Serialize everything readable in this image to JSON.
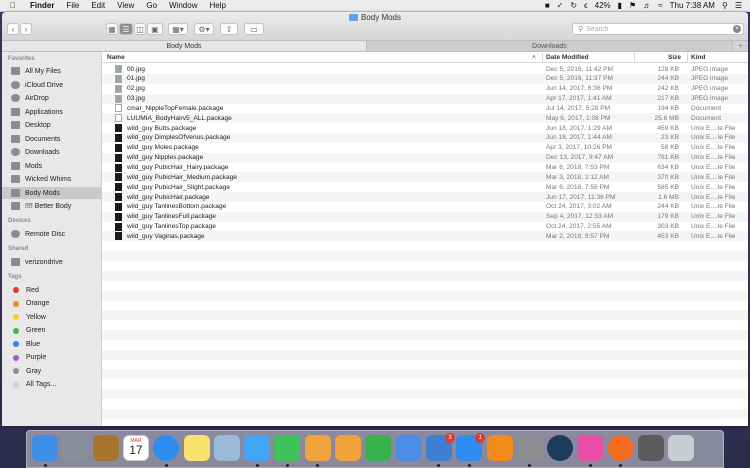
{
  "menubar": {
    "app_name": "Finder",
    "menus": [
      "File",
      "Edit",
      "View",
      "Go",
      "Window",
      "Help"
    ],
    "battery": "42%",
    "clock": "Thu 7:38 AM"
  },
  "window": {
    "title": "Body Mods",
    "search_placeholder": "Search",
    "tabs": [
      "Body Mods",
      "Downloads"
    ],
    "plus": "+"
  },
  "sidebar": {
    "favorites_label": "Favorites",
    "favorites": [
      "All My Files",
      "iCloud Drive",
      "AirDrop",
      "Applications",
      "Desktop",
      "Documents",
      "Downloads",
      "Mods",
      "Wicked Whims",
      "Body Mods",
      "!!!! Better Body"
    ],
    "selected": "Body Mods",
    "devices_label": "Devices",
    "devices": [
      "Remote Disc"
    ],
    "shared_label": "Shared",
    "shared": [
      "verizondrive"
    ],
    "tags_label": "Tags",
    "tags": [
      {
        "label": "Red",
        "color": "#e0372e"
      },
      {
        "label": "Orange",
        "color": "#f28a1c"
      },
      {
        "label": "Yellow",
        "color": "#f4cc2a"
      },
      {
        "label": "Green",
        "color": "#3bb94a"
      },
      {
        "label": "Blue",
        "color": "#2f7ff0"
      },
      {
        "label": "Purple",
        "color": "#a65bd0"
      },
      {
        "label": "Gray",
        "color": "#8e8e93"
      },
      {
        "label": "All Tags...",
        "color": "#d0d0d0"
      }
    ]
  },
  "list": {
    "columns": {
      "name": "Name",
      "date": "Date Modified",
      "size": "Size",
      "kind": "Kind"
    },
    "rows": [
      {
        "name": "00.jpg",
        "date": "Dec 5, 2016, 11:42 PM",
        "size": "128 KB",
        "kind": "JPEG image",
        "icon": "jpg"
      },
      {
        "name": "01.jpg",
        "date": "Dec 5, 2016, 11:37 PM",
        "size": "244 KB",
        "kind": "JPEG image",
        "icon": "jpg"
      },
      {
        "name": "02.jpg",
        "date": "Jun 14, 2017, 6:36 PM",
        "size": "242 KB",
        "kind": "JPEG image",
        "icon": "jpg"
      },
      {
        "name": "03.jpg",
        "date": "Apr 17, 2017, 1:41 AM",
        "size": "217 KB",
        "kind": "JPEG image",
        "icon": "jpg"
      },
      {
        "name": "cmar_NippleTopFemale.package",
        "date": "Jul 14, 2017, 5:28 PM",
        "size": "194 KB",
        "kind": "Document",
        "icon": "doc"
      },
      {
        "name": "LUUMIA_BodyHairv5_ALL.package",
        "date": "May 6, 2017, 1:08 PM",
        "size": "25.6 MB",
        "kind": "Document",
        "icon": "doc"
      },
      {
        "name": "wild_guy Butts.package",
        "date": "Jun 18, 2017, 1:29 AM",
        "size": "459 KB",
        "kind": "Unix E....le File",
        "icon": "unix"
      },
      {
        "name": "wild_guy DimplesOfVenus.package",
        "date": "Jun 18, 2017, 1:44 AM",
        "size": "23 KB",
        "kind": "Unix E....le File",
        "icon": "unix"
      },
      {
        "name": "wild_guy Moles.package",
        "date": "Apr 3, 2017, 10:26 PM",
        "size": "58 KB",
        "kind": "Unix E....le File",
        "icon": "unix"
      },
      {
        "name": "wild_guy Nipples.package",
        "date": "Dec 13, 2017, 9:47 AM",
        "size": "781 KB",
        "kind": "Unix E....le File",
        "icon": "unix"
      },
      {
        "name": "wild_guy PubicHair_Hairy.package",
        "date": "Mar 6, 2018, 7:53 PM",
        "size": "634 KB",
        "kind": "Unix E....le File",
        "icon": "unix"
      },
      {
        "name": "wild_guy PubicHair_Medium.package",
        "date": "Mar 3, 2018, 2:12 AM",
        "size": "370 KB",
        "kind": "Unix E....le File",
        "icon": "unix"
      },
      {
        "name": "wild_guy PubicHair_Slight.package",
        "date": "Mar 6, 2018, 7:55 PM",
        "size": "585 KB",
        "kind": "Unix E....le File",
        "icon": "unix"
      },
      {
        "name": "wild_guy PubicHair.package",
        "date": "Jun 17, 2017, 11:36 PM",
        "size": "1.6 MB",
        "kind": "Unix E....le File",
        "icon": "unix"
      },
      {
        "name": "wild_guy TanlinesBottom.package",
        "date": "Oct 24, 2017, 3:02 AM",
        "size": "244 KB",
        "kind": "Unix E....le File",
        "icon": "unix"
      },
      {
        "name": "wild_guy TanlinesFull.package",
        "date": "Sep 4, 2017, 12:33 AM",
        "size": "179 KB",
        "kind": "Unix E....le File",
        "icon": "unix"
      },
      {
        "name": "wild_guy TanlinesTop.package",
        "date": "Oct 24, 2017, 2:55 AM",
        "size": "303 KB",
        "kind": "Unix E....le File",
        "icon": "unix"
      },
      {
        "name": "wild_guy Vaginas.package",
        "date": "Mar 2, 2018, 9:57 PM",
        "size": "453 KB",
        "kind": "Unix E....le File",
        "icon": "unix"
      }
    ]
  },
  "dock": {
    "apps": [
      {
        "name": "finder-icon",
        "color": "#3e8ee8"
      },
      {
        "name": "launchpad-icon",
        "color": "#8a8f99"
      },
      {
        "name": "notes-book-icon",
        "color": "#a9742e"
      },
      {
        "name": "calendar-icon",
        "color": "#ffffff"
      },
      {
        "name": "safari-icon",
        "color": "#2d8ef0"
      },
      {
        "name": "stickies-icon",
        "color": "#f7e36b"
      },
      {
        "name": "preview-icon",
        "color": "#9bb9d8"
      },
      {
        "name": "messages-icon",
        "color": "#42a5f5"
      },
      {
        "name": "facetime-icon",
        "color": "#3cc35a"
      },
      {
        "name": "photos-icon",
        "color": "#f2a43c"
      },
      {
        "name": "pages-icon",
        "color": "#f0a23a"
      },
      {
        "name": "numbers-icon",
        "color": "#37b24d"
      },
      {
        "name": "keynote-icon",
        "color": "#4c8ee6"
      },
      {
        "name": "keynote-stand-icon",
        "color": "#3f7fd3"
      },
      {
        "name": "app-store-icon",
        "color": "#2f8cf0"
      },
      {
        "name": "ibooks-icon",
        "color": "#f28a1c"
      },
      {
        "name": "system-preferences-icon",
        "color": "#8d8d92"
      },
      {
        "name": "quicktime-icon",
        "color": "#1d3b5e"
      },
      {
        "name": "itunes-icon",
        "color": "#e84fa8"
      },
      {
        "name": "origin-icon",
        "color": "#f46b1f"
      },
      {
        "name": "calculator-icon",
        "color": "#5c5c5c"
      },
      {
        "name": "trash-icon",
        "color": "#c9ccd1"
      }
    ],
    "calendar_month": "MAR",
    "calendar_day": "17",
    "keynote_badge": "3",
    "appstore_badge": "1"
  }
}
